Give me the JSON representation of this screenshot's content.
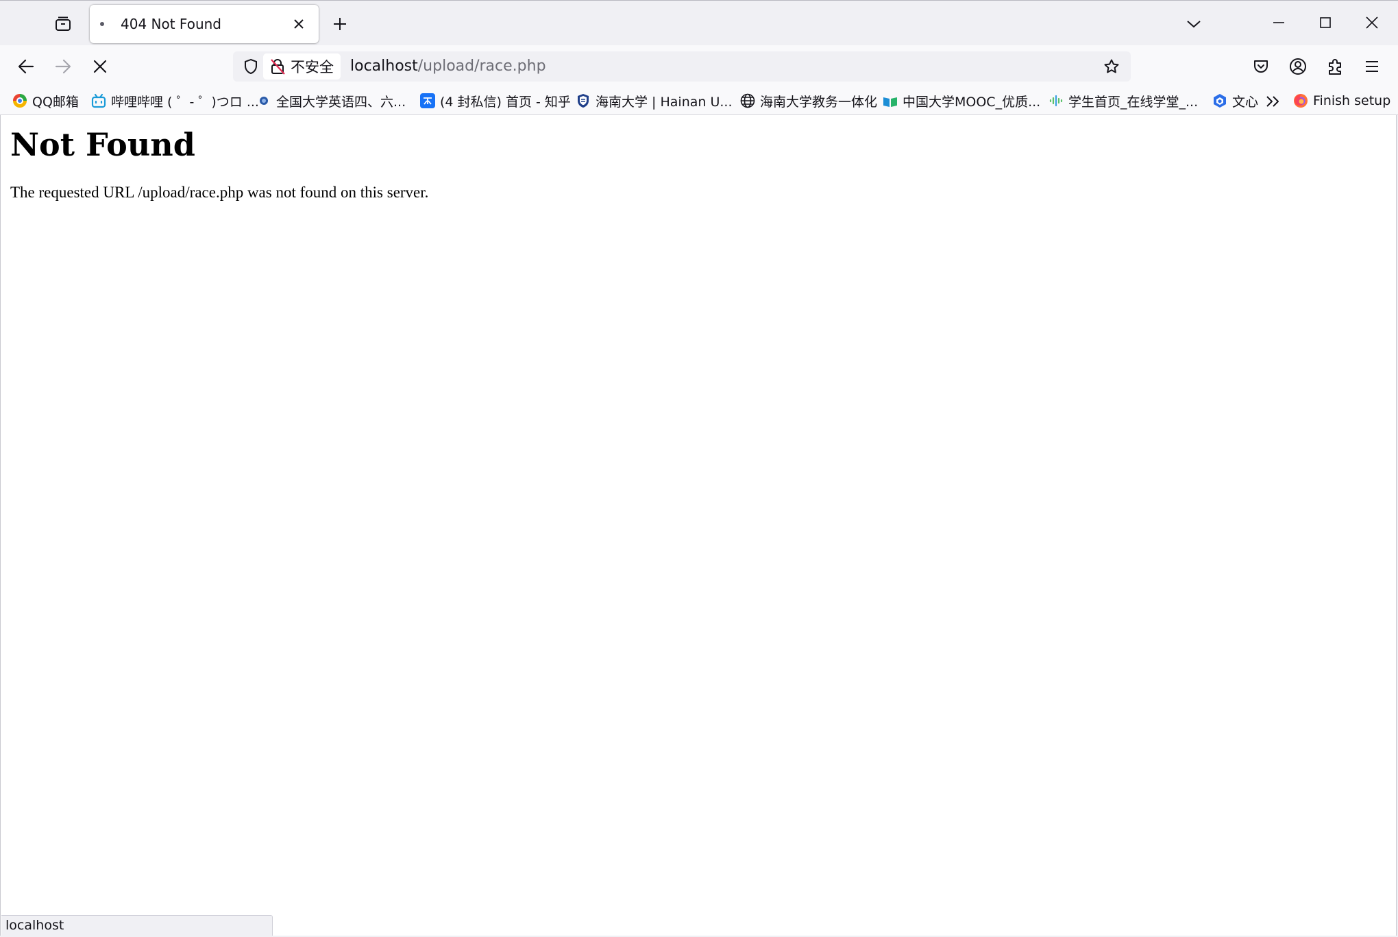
{
  "window": {
    "colors": {
      "accent_text": "#15141a",
      "chrome_bg": "#f0f0f4",
      "toolbar_bg": "#f9f9fb",
      "url_path": "#6d6d75"
    }
  },
  "tabs": [
    {
      "title": "404 Not Found",
      "active": true
    }
  ],
  "navbar": {
    "security_label": "不安全",
    "url_host": "localhost",
    "url_path": "/upload/race.php"
  },
  "bookmarks": [
    {
      "label": "QQ邮箱",
      "icon": "qq-mail-icon"
    },
    {
      "label": "哔哩哔哩 ( ゜- ゜)つロ ...",
      "icon": "bilibili-icon"
    },
    {
      "label": "全国大学英语四、六...",
      "icon": "cet-icon"
    },
    {
      "label": "(4 封私信) 首页 - 知乎",
      "icon": "zhihu-icon"
    },
    {
      "label": "海南大学 | Hainan U...",
      "icon": "hainan-university-icon"
    },
    {
      "label": "海南大学教务一体化",
      "icon": "globe-icon"
    },
    {
      "label": "中国大学MOOC_优质...",
      "icon": "mooc-icon"
    },
    {
      "label": "学生首页_在线学堂_...",
      "icon": "xuetang-icon"
    },
    {
      "label": "文心",
      "icon": "wenxin-icon"
    },
    {
      "label": "Finish setup",
      "icon": "firefox-icon"
    }
  ],
  "page": {
    "heading": "Not Found",
    "message": "The requested URL /upload/race.php was not found on this server."
  },
  "status": {
    "text": "localhost"
  }
}
